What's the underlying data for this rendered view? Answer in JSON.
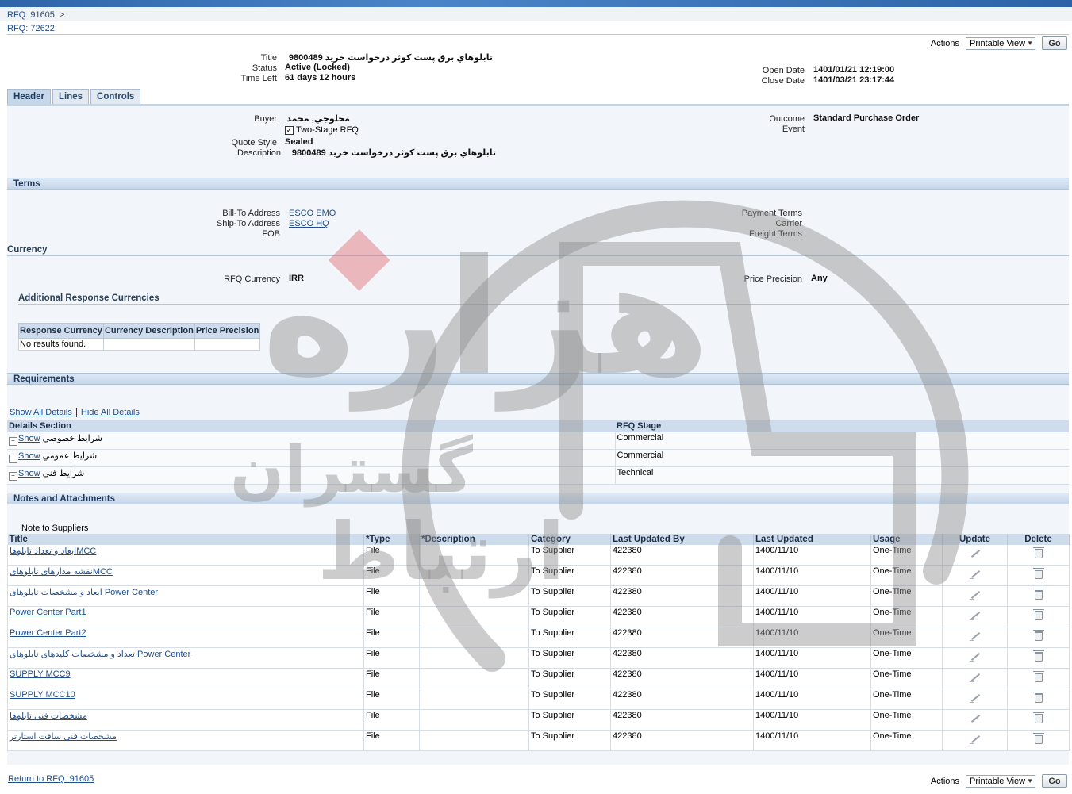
{
  "breadcrumbs": {
    "parent": "RFQ: 91605",
    "separator": ">",
    "current": "RFQ: 72622"
  },
  "actions": {
    "label": "Actions",
    "selected": "Printable View",
    "go": "Go"
  },
  "summary": {
    "title_label": "Title",
    "title_value": "تابلوهاي برق پست كوثر درخواست خريد 9800489",
    "status_label": "Status",
    "status_value": "Active (Locked)",
    "time_left_label": "Time Left",
    "time_left_value": "61 days 12 hours",
    "open_date_label": "Open Date",
    "open_date_value": "1401/01/21 12:19:00",
    "close_date_label": "Close Date",
    "close_date_value": "1401/03/21 23:17:44"
  },
  "tabs": [
    "Header",
    "Lines",
    "Controls"
  ],
  "header": {
    "buyer_label": "Buyer",
    "buyer_value": "محلوجي, محمد",
    "two_stage_label": "Two-Stage RFQ",
    "quote_style_label": "Quote Style",
    "quote_style_value": "Sealed",
    "description_label": "Description",
    "description_value": "تابلوهاي برق پست كوثر درخواست خريد 9800489",
    "outcome_label": "Outcome",
    "outcome_value": "Standard Purchase Order",
    "event_label": "Event"
  },
  "terms": {
    "section_title": "Terms",
    "bill_to_label": "Bill-To Address",
    "bill_to_value": "ESCO EMO",
    "ship_to_label": "Ship-To Address",
    "ship_to_value": "ESCO HQ",
    "fob_label": "FOB",
    "payment_terms_label": "Payment Terms",
    "carrier_label": "Carrier",
    "freight_terms_label": "Freight Terms"
  },
  "currency": {
    "section_title": "Currency",
    "rfq_currency_label": "RFQ Currency",
    "rfq_currency_value": "IRR",
    "price_precision_label": "Price Precision",
    "price_precision_value": "Any",
    "additional_title": "Additional Response Currencies",
    "columns": [
      "Response Currency",
      "Currency Description",
      "Price Precision"
    ],
    "empty_text": "No results found."
  },
  "requirements": {
    "section_title": "Requirements",
    "show_all": "Show All Details",
    "hide_all": "Hide All Details",
    "columns": [
      "Details Section",
      "RFQ Stage"
    ],
    "show_label": "Show",
    "rows": [
      {
        "section": "شرايط خصوصي",
        "stage": "Commercial"
      },
      {
        "section": "شرايط عمومي",
        "stage": "Commercial"
      },
      {
        "section": "شرايط فني",
        "stage": "Technical"
      }
    ]
  },
  "notes": {
    "section_title": "Notes and Attachments",
    "note_label": "Note to Suppliers",
    "columns": [
      "Title",
      "*Type",
      "*Description",
      "Category",
      "Last Updated By",
      "Last Updated",
      "Usage",
      "Update",
      "Delete"
    ],
    "rows": [
      {
        "title": "ابعاد و تعداد تابلوهاMCC",
        "type": "File",
        "description": "",
        "category": "To Supplier",
        "updated_by": "422380",
        "updated": "1400/11/10",
        "usage": "One-Time"
      },
      {
        "title": "نقشه مدارهای تابلوهایMCC",
        "type": "File",
        "description": "",
        "category": "To Supplier",
        "updated_by": "422380",
        "updated": "1400/11/10",
        "usage": "One-Time"
      },
      {
        "title": "ابعاد و مشخصات تابلوهای Power Center",
        "type": "File",
        "description": "",
        "category": "To Supplier",
        "updated_by": "422380",
        "updated": "1400/11/10",
        "usage": "One-Time"
      },
      {
        "title": "Power Center Part1",
        "type": "File",
        "description": "",
        "category": "To Supplier",
        "updated_by": "422380",
        "updated": "1400/11/10",
        "usage": "One-Time"
      },
      {
        "title": "Power Center Part2",
        "type": "File",
        "description": "",
        "category": "To Supplier",
        "updated_by": "422380",
        "updated": "1400/11/10",
        "usage": "One-Time"
      },
      {
        "title": "تعداد و مشخصات کلیدهای تابلوهای Power Center",
        "type": "File",
        "description": "",
        "category": "To Supplier",
        "updated_by": "422380",
        "updated": "1400/11/10",
        "usage": "One-Time"
      },
      {
        "title": "SUPPLY MCC9",
        "type": "File",
        "description": "",
        "category": "To Supplier",
        "updated_by": "422380",
        "updated": "1400/11/10",
        "usage": "One-Time"
      },
      {
        "title": "SUPPLY MCC10",
        "type": "File",
        "description": "",
        "category": "To Supplier",
        "updated_by": "422380",
        "updated": "1400/11/10",
        "usage": "One-Time"
      },
      {
        "title": "مشخصات فنی تابلوها",
        "type": "File",
        "description": "",
        "category": "To Supplier",
        "updated_by": "422380",
        "updated": "1400/11/10",
        "usage": "One-Time"
      },
      {
        "title": "مشخصات فنی سافت استارتر",
        "type": "File",
        "description": "",
        "category": "To Supplier",
        "updated_by": "422380",
        "updated": "1400/11/10",
        "usage": "One-Time"
      }
    ]
  },
  "footer": {
    "return_link": "Return to RFQ: 91605"
  },
  "watermark": {
    "line1": "هزاره",
    "line2": "گستران",
    "line3": "ارتباط"
  }
}
